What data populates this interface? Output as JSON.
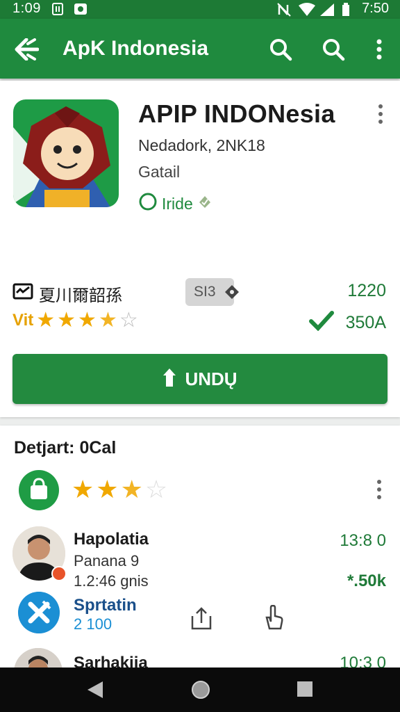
{
  "status_bar": {
    "time_left": "1:09",
    "time_right": "7:50"
  },
  "appbar": {
    "title": "ApK Indonesia"
  },
  "app": {
    "title": "APIP INDONesia",
    "developer": "Nedadork, 2NK18",
    "category": "Gatail",
    "install_badge": "Iride",
    "meta_label": "夏川爾韶孫",
    "chip": "SI3",
    "downloads": "1220",
    "rating_prefix": "Vit",
    "rating": 3.5,
    "rating_count": "350A"
  },
  "install_button": {
    "label": "UNDŲ"
  },
  "section": {
    "title": "Detjart: 0Cal",
    "rating": 2.5
  },
  "list": [
    {
      "name": "Hapolatia",
      "sub1": "Panana 9",
      "sub2": "1.2:46 gnis",
      "right1": "13:8 0",
      "right2": "*.50k"
    },
    {
      "name": "Sprtatin",
      "sub1": "2 100",
      "right1": "",
      "right2": ""
    },
    {
      "name": "Sarhakija",
      "sub1": "",
      "right1": "10:3 0",
      "right2": ""
    }
  ],
  "colors": {
    "primary": "#1f8a3e",
    "primary_dark": "#1d7a35",
    "star": "#f0a800"
  }
}
